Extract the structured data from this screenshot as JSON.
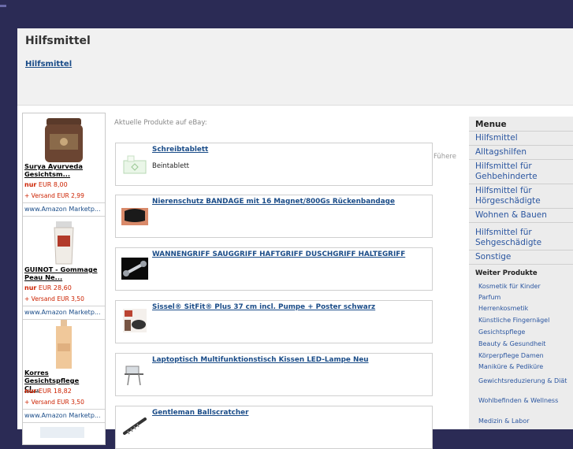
{
  "header": {
    "title": "Hilfsmittel",
    "breadcrumb": "Hilfsmittel"
  },
  "amazon": {
    "items": [
      {
        "title_line1": "Surya Ayurveda",
        "title_line2": "Gesichtsm...",
        "price_prefix": "nur",
        "price": "EUR 8,00",
        "shipping": "+ Versand EUR 2,99",
        "source": "www.Amazon Marketp..."
      },
      {
        "title_line1": "GUINOT - Gommage",
        "title_line2": "Peau Ne...",
        "price_prefix": "nur",
        "price": "EUR 28,60",
        "shipping": "+ Versand EUR 3,50",
        "source": "www.Amazon Marketp..."
      },
      {
        "title_line1": "Korres Gesichtspflege",
        "title_line2": "Cl...",
        "price_prefix": "nur",
        "price": "EUR 18,82",
        "shipping": "+ Versand EUR 3,50",
        "source": "www.Amazon Marketp..."
      }
    ]
  },
  "ebay": {
    "caption": "Aktuelle Produkte auf eBay:",
    "side_text": "Fühere",
    "products": [
      {
        "title": "Schreibtablett",
        "subtitle": "Beintablett"
      },
      {
        "title": "Nierenschutz BANDAGE mit 16 Magnet/800Gs Rückenbandage",
        "subtitle": ""
      },
      {
        "title": "WANNENGRIFF SAUGGRIFF HAFTGRIFF DUSCHGRIFF HALTEGRIFF",
        "subtitle": ""
      },
      {
        "title": "Sissel® SitFit® Plus 37 cm incl. Pumpe + Poster schwarz",
        "subtitle": ""
      },
      {
        "title": "Laptoptisch Multifunktionstisch Kissen LED-Lampe Neu",
        "subtitle": ""
      },
      {
        "title": "Gentleman Ballscratcher",
        "subtitle": ""
      }
    ]
  },
  "menu": {
    "title": "Menue",
    "items": [
      "Hilfsmittel",
      "Alltagshilfen",
      "Hilfsmittel für Gehbehinderte",
      "Hilfsmittel für Hörgeschädigte",
      "Wohnen & Bauen",
      "Hilfsmittel für Sehgeschädigte",
      "Sonstige"
    ],
    "more_title": "Weiter Produkte",
    "more_items": [
      "Kosmetik für Kinder",
      "Parfum",
      "Herrenkosmetik",
      "Künstliche Fingernägel",
      "Gesichtspflege",
      "Beauty & Gesundheit",
      "Körperpflege Damen",
      "Maniküre & Pediküre",
      "Gewichtsreduzierung & Diät",
      "Wohlbefinden & Wellness",
      "Medizin & Labor"
    ]
  },
  "colors": {
    "background": "#2b2b55",
    "link": "#1a4c88",
    "menu_link": "#2b56a0",
    "price": "#cc2200"
  }
}
